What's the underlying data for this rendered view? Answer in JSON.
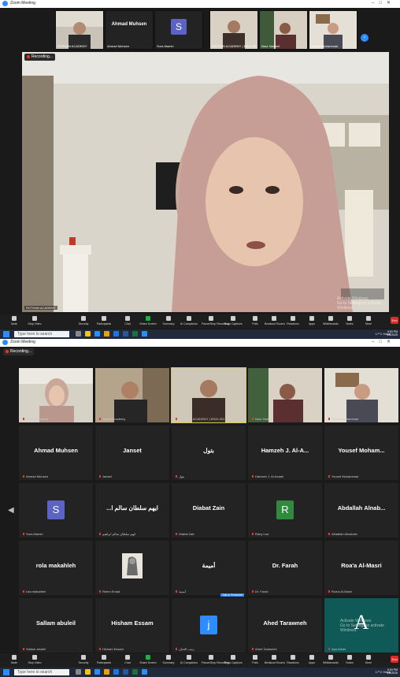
{
  "window": {
    "title": "Zoom Meeting"
  },
  "top": {
    "strip": [
      {
        "name": "ROTHAN ACADEMY",
        "kind": "video"
      },
      {
        "name": "Ahmad Muhsen",
        "kind": "text",
        "sub": "Ahmad Muhsen"
      },
      {
        "name": "Sura Alamin",
        "kind": "avatar",
        "letter": "S",
        "color": "#5b63c7"
      },
      {
        "name": "ROTHAN ACADEMY | ENGLISH",
        "kind": "video"
      },
      {
        "name": "Nour Naddaf",
        "kind": "video"
      },
      {
        "name": "Yousef Mohammad",
        "kind": "video"
      }
    ],
    "recording": "Recording...",
    "video_label": "ROTHAN ACADEMY",
    "activate": {
      "line1": "Activate Windows",
      "line2": "Go to Settings to activate Windows."
    }
  },
  "bottom": {
    "recording": "Recording...",
    "grid": [
      {
        "name": "",
        "sub": "Fadia A. Khaled",
        "kind": "video"
      },
      {
        "name": "",
        "sub": "Janset Academy",
        "kind": "video"
      },
      {
        "name": "",
        "sub": "ROTHAN ACADEMY | ENGLISH",
        "kind": "video",
        "active": true
      },
      {
        "name": "",
        "sub": "Nour Naddaf",
        "kind": "video"
      },
      {
        "name": "",
        "sub": "Yousef Mohammad",
        "kind": "video"
      },
      {
        "name": "Ahmad Muhsen",
        "sub": "Ahmad Muhsen"
      },
      {
        "name": "Janset",
        "sub": "Janset"
      },
      {
        "name": "بتول",
        "sub": "بتول"
      },
      {
        "name": "Hamzeh J. Al-A...",
        "sub": "Hamzeh J. Al-Amairi"
      },
      {
        "name": "Yousef  Moham...",
        "sub": "Yousef Mohammad"
      },
      {
        "name": "",
        "sub": "Sura Alamin",
        "avatar": "S",
        "color": "#5b63c7"
      },
      {
        "name": "...ايهم سلطان سالم ا",
        "sub": "ايهم سلطان سالم ابراهيم"
      },
      {
        "name": "Diabat Zain",
        "sub": "Diabat Zain"
      },
      {
        "name": "",
        "sub": "Rany Lua",
        "avatar": "R",
        "color": "#2f8a3d"
      },
      {
        "name": "Abdallah Alnab...",
        "sub": "Abdallah Alnabulsi"
      },
      {
        "name": "rola makahleh",
        "sub": "rola makahleh"
      },
      {
        "name": "",
        "sub": "Reem Emad",
        "picture": true
      },
      {
        "name": "أميمة",
        "sub": "أميمة"
      },
      {
        "name": "Dr. Farah",
        "sub": "Dr. Farah"
      },
      {
        "name": "Roa'a Al-Masri",
        "sub": "Roa'a Al-Masri"
      },
      {
        "name": "Sallam abuleil",
        "sub": "Sallam abuleil"
      },
      {
        "name": "Hisham Essam",
        "sub": "Hisham Essam"
      },
      {
        "name": "",
        "sub": "زينب الحنان",
        "avatar": "j",
        "color": "#2d8cff",
        "tag": "Talk to Presenter"
      },
      {
        "name": "Ahed Tarawneh",
        "sub": "Ahed Tarawneh"
      },
      {
        "name": "",
        "sub": "Aya Zaher",
        "bigA": "A"
      }
    ],
    "activate": {
      "line1": "Activate Windows",
      "line2": "Go to Settings to activate Windows."
    }
  },
  "toolbar": {
    "items": [
      "Mute",
      "Stop Video",
      "Security",
      "Participants",
      "Chat",
      "Share Screen",
      "Summary",
      "AI Companion",
      "Pause/Stop Recording",
      "Show Captions",
      "Polls",
      "Breakout Rooms",
      "Reactions",
      "Apps",
      "Whiteboards",
      "Notes",
      "More"
    ],
    "participants_count": "24",
    "end": "End"
  },
  "taskbar": {
    "search_placeholder": "Type here to search",
    "weather": "17°C  Haze",
    "time": "6:53 PM",
    "date": "1/5/2025"
  }
}
